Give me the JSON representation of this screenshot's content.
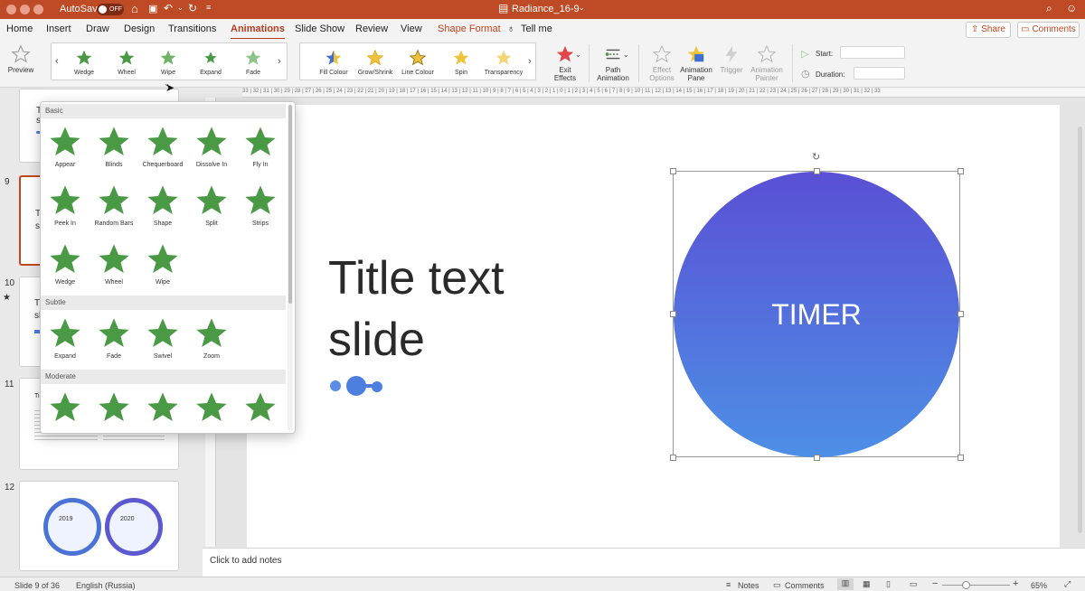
{
  "titlebar": {
    "autosave_label": "AutoSave",
    "autosave_state": "OFF",
    "document_title": "Radiance_16-9"
  },
  "menu": {
    "items": [
      "Home",
      "Insert",
      "Draw",
      "Design",
      "Transitions",
      "Animations",
      "Slide Show",
      "Review",
      "View",
      "Shape Format",
      "Tell me"
    ],
    "share": "Share",
    "comments": "Comments"
  },
  "ribbon": {
    "preview": "Preview",
    "entrance_gallery": [
      "Wedge",
      "Wheel",
      "Wipe",
      "Expand",
      "Fade"
    ],
    "emphasis_gallery": [
      "Fill Colour",
      "Grow/Shrink",
      "Line Colour",
      "Spin",
      "Transparency"
    ],
    "exit_effects": "Exit Effects",
    "path_animation": "Path Animation",
    "effect_options": "Effect Options",
    "animation_pane": "Animation Pane",
    "trigger": "Trigger",
    "animation_painter": "Animation Painter",
    "start_label": "Start:",
    "duration_label": "Duration:"
  },
  "ruler_text": "33 | 32 | 31 | 30 | 29 | 28 | 27 | 26 | 25 | 24 | 23 | 22 | 21 | 20 | 19 | 18 | 17 | 16 | 15 | 14 | 13 | 12 | 11 | 10 | 9 | 8 | 7 | 6 | 5 | 4 | 3 | 2 | 1 | 0 | 1 | 2 | 3 | 4 | 5 | 6 | 7 | 8 | 9 | 10 | 11 | 12 | 13 | 14 | 15 | 16 | 17 | 18 | 19 | 20 | 21 | 22 | 23 | 24 | 25 | 26 | 27 | 28 | 29 | 30 | 31 | 32 | 33",
  "sidebar": {
    "slides": [
      {
        "num": "9",
        "text": "Ti sl"
      },
      {
        "num": "10",
        "text": "Ti sl"
      },
      {
        "num": "11",
        "text": "Ti"
      },
      {
        "num": "12",
        "text": ""
      }
    ],
    "thumb12": {
      "year1": "2019",
      "year2": "2020"
    }
  },
  "animation_popup": {
    "section_basic": "Basic",
    "basic": [
      "Appear",
      "Blinds",
      "Chequerboard",
      "Dissolve In",
      "Fly In",
      "Peek In",
      "Random Bars",
      "Shape",
      "Split",
      "Strips",
      "Wedge",
      "Wheel",
      "Wipe"
    ],
    "section_subtle": "Subtle",
    "subtle": [
      "Expand",
      "Fade",
      "Swivel",
      "Zoom"
    ],
    "section_moderate": "Moderate"
  },
  "slide": {
    "title_line1": "Title text",
    "title_line2": "slide",
    "circle_text": "TIMER"
  },
  "notes": {
    "placeholder": "Click to add notes"
  },
  "status": {
    "slide_counter": "Slide 9 of 36",
    "language": "English (Russia)",
    "notes": "Notes",
    "comments": "Comments",
    "zoom": "65%"
  },
  "colors": {
    "titlebar": "#bf4a26",
    "accent": "#c3461f",
    "star_green": "#4a9a45",
    "circle_top": "#5a50d4",
    "circle_bottom": "#4d8fe6"
  }
}
